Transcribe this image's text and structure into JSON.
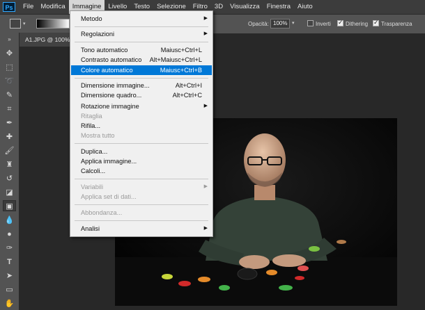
{
  "app": {
    "logo": "Ps"
  },
  "menubar": {
    "items": [
      "File",
      "Modifica",
      "Immagine",
      "Livello",
      "Testo",
      "Selezione",
      "Filtro",
      "3D",
      "Visualizza",
      "Finestra",
      "Aiuto"
    ],
    "active_index": 2
  },
  "options_bar": {
    "opacity_label": "Opacità:",
    "opacity_value": "100%",
    "inverti_label": "Inverti",
    "inverti_checked": false,
    "dithering_label": "Dithering",
    "dithering_checked": true,
    "trasparenza_label": "Trasparenza",
    "trasparenza_checked": true
  },
  "document": {
    "tab_title": "A1.JPG @ 100%"
  },
  "dropdown": {
    "items": [
      {
        "label": "Metodo",
        "shortcut": "",
        "submenu": true,
        "disabled": false
      },
      {
        "label": "Regolazioni",
        "shortcut": "",
        "submenu": true,
        "disabled": false
      },
      {
        "label": "Tono automatico",
        "shortcut": "Maiusc+Ctrl+L",
        "submenu": false,
        "disabled": false
      },
      {
        "label": "Contrasto automatico",
        "shortcut": "Alt+Maiusc+Ctrl+L",
        "submenu": false,
        "disabled": false
      },
      {
        "label": "Colore automatico",
        "shortcut": "Maiusc+Ctrl+B",
        "submenu": false,
        "disabled": false,
        "highlighted": true
      },
      {
        "label": "Dimensione immagine...",
        "shortcut": "Alt+Ctrl+I",
        "submenu": false,
        "disabled": false
      },
      {
        "label": "Dimensione quadro...",
        "shortcut": "Alt+Ctrl+C",
        "submenu": false,
        "disabled": false
      },
      {
        "label": "Rotazione immagine",
        "shortcut": "",
        "submenu": true,
        "disabled": false
      },
      {
        "label": "Ritaglia",
        "shortcut": "",
        "submenu": false,
        "disabled": true
      },
      {
        "label": "Rifila...",
        "shortcut": "",
        "submenu": false,
        "disabled": false
      },
      {
        "label": "Mostra tutto",
        "shortcut": "",
        "submenu": false,
        "disabled": true
      },
      {
        "label": "Duplica...",
        "shortcut": "",
        "submenu": false,
        "disabled": false
      },
      {
        "label": "Applica immagine...",
        "shortcut": "",
        "submenu": false,
        "disabled": false
      },
      {
        "label": "Calcoli...",
        "shortcut": "",
        "submenu": false,
        "disabled": false
      },
      {
        "label": "Variabili",
        "shortcut": "",
        "submenu": true,
        "disabled": true
      },
      {
        "label": "Applica set di dati...",
        "shortcut": "",
        "submenu": false,
        "disabled": true
      },
      {
        "label": "Abbondanza...",
        "shortcut": "",
        "submenu": false,
        "disabled": true
      },
      {
        "label": "Analisi",
        "shortcut": "",
        "submenu": true,
        "disabled": false
      }
    ]
  },
  "tools": [
    "move-tool",
    "marquee-tool",
    "lasso-tool",
    "quick-selection-tool",
    "crop-tool",
    "eyedropper-tool",
    "healing-brush-tool",
    "brush-tool",
    "clone-stamp-tool",
    "history-brush-tool",
    "eraser-tool",
    "gradient-tool",
    "blur-tool",
    "dodge-tool",
    "pen-tool",
    "type-tool",
    "path-selection-tool",
    "rectangle-tool",
    "hand-tool"
  ]
}
